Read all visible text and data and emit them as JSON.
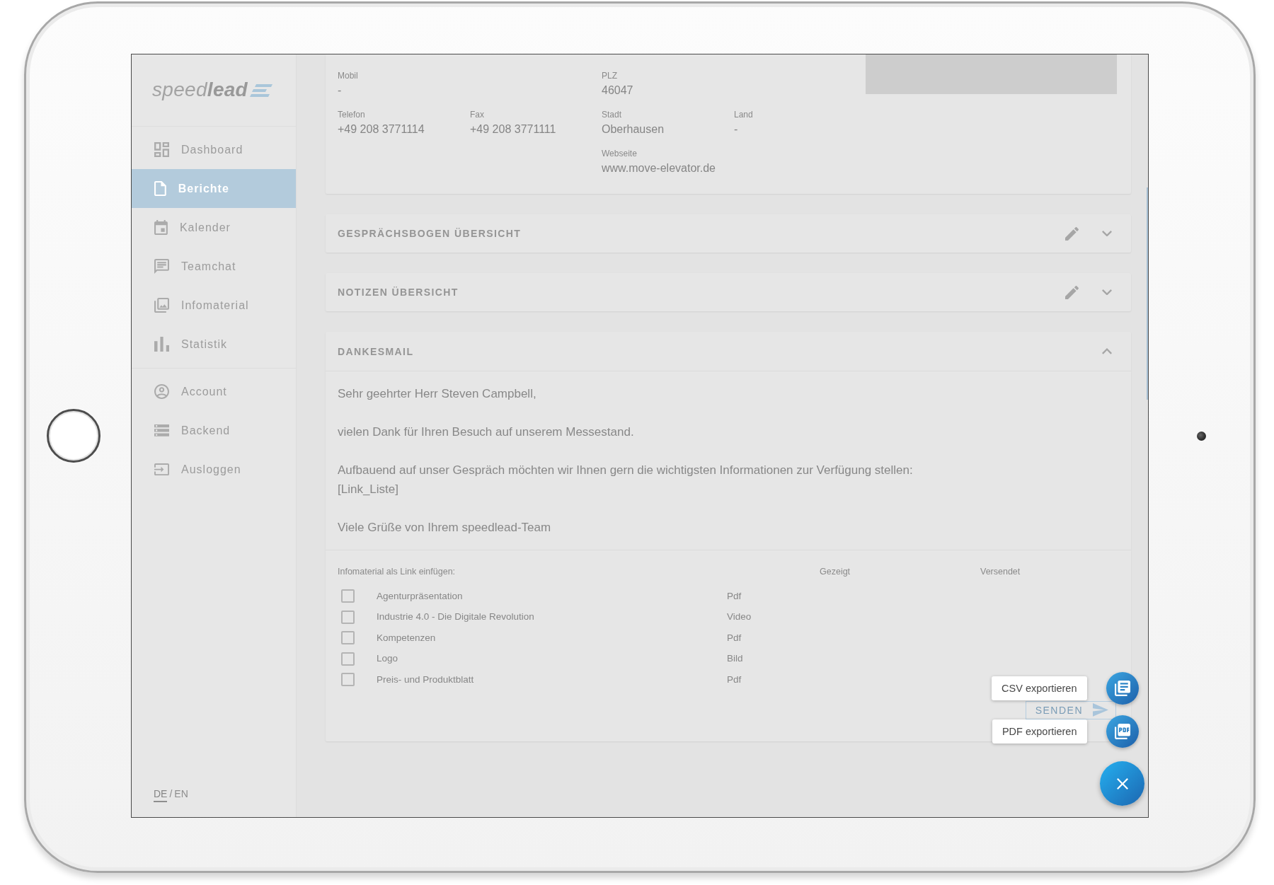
{
  "sidebar": {
    "logo": "speed**lead**",
    "nav_sections": [
      {
        "items": [
          {
            "label": "Dashboard",
            "selected": false
          },
          {
            "label": "Berichte",
            "selected": true
          },
          {
            "label": "Kalender",
            "selected": false
          },
          {
            "label": "Teamchat",
            "selected": false
          },
          {
            "label": "Infomaterial",
            "selected": false
          },
          {
            "label": "Statistik",
            "selected": false
          }
        ]
      },
      {
        "items": [
          {
            "label": "Account",
            "selected": false
          },
          {
            "label": "Backend",
            "selected": false
          },
          {
            "label": "Ausloggen",
            "selected": false
          }
        ]
      }
    ],
    "languages": [
      {
        "label": "DE",
        "selected": true
      },
      {
        "label": "EN",
        "selected": false
      }
    ],
    "language_separator": "/"
  },
  "contact_card": {
    "contact_fields": [
      {
        "label": "Mobil",
        "value": "-"
      },
      {
        "label": "Telefon",
        "value": "+49 208 3771114"
      },
      {
        "label": "Fax",
        "value": "+49 208 3771111"
      }
    ],
    "address_fields": [
      {
        "label": "PLZ",
        "value": "46047"
      },
      {
        "label": "Stadt",
        "value": "Oberhausen"
      },
      {
        "label": "Land",
        "value": "-"
      },
      {
        "label": "Webseite",
        "value": "www.move-elevator.de"
      }
    ]
  },
  "accordions": [
    {
      "title": "GESPRÄCHSBOGEN ÜBERSICHT",
      "editable": true,
      "expanded": false
    },
    {
      "title": "NOTIZEN ÜBERSICHT",
      "editable": true,
      "expanded": false
    },
    {
      "title": "DANKESMAIL",
      "editable": false,
      "expanded": true,
      "mail": {
        "paragraphs": [
          "Sehr geehrter Herr Steven Campbell,",
          "vielen Dank für Ihren Besuch auf unserem Messestand.",
          "Aufbauend auf unser Gespräch möchten wir Ihnen gern die wichtigsten Informationen zur Verfügung stellen:\n[Link_Liste]",
          "Viele Grüße von Ihrem speedlead-Team"
        ],
        "infomaterial": {
          "heading": "Infomaterial als Link einfügen:",
          "columns": [
            "Gezeigt",
            "Versendet"
          ],
          "rows": [
            {
              "name": "Agenturpräsentation",
              "type": "Pdf",
              "checked": false
            },
            {
              "name": "Industrie 4.0 - Die Digitale Revolution",
              "type": "Video",
              "checked": false
            },
            {
              "name": "Kompetenzen",
              "type": "Pdf",
              "checked": false
            },
            {
              "name": "Logo",
              "type": "Bild",
              "checked": false
            },
            {
              "name": "Preis- und Produktblatt",
              "type": "Pdf",
              "checked": false
            }
          ]
        },
        "send_button": "SENDEN"
      }
    }
  ],
  "export_menu": {
    "expanded": true,
    "actions": [
      {
        "kind": "csv",
        "label": "CSV exportieren"
      },
      {
        "kind": "pdf",
        "label": "PDF exportieren"
      }
    ]
  }
}
